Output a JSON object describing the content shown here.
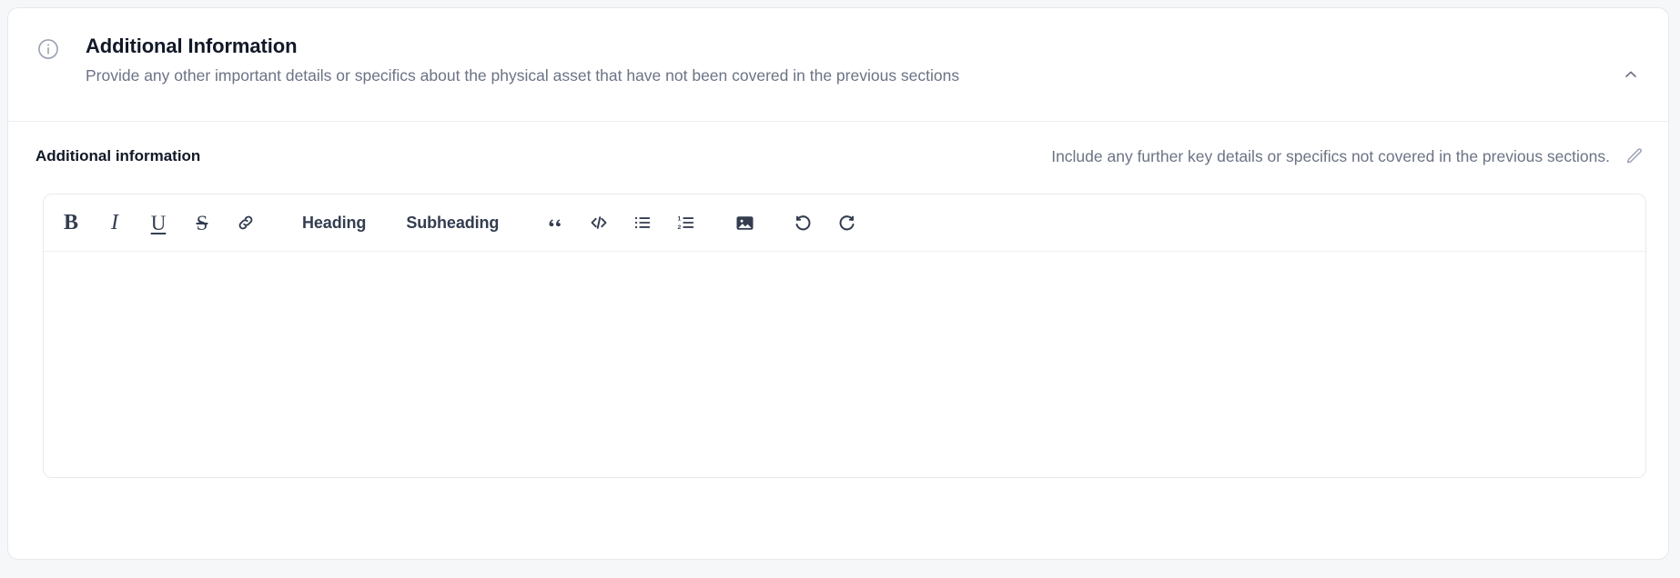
{
  "theme": {
    "page_background": "#f6f7f9",
    "card_background": "#ffffff",
    "border": "#e7e9ee",
    "title_color": "#111827",
    "muted_text": "#6b7385",
    "toolbar_icon": "#343d50"
  },
  "section": {
    "icon": "info-circle-icon",
    "title": "Additional Information",
    "subtitle": "Provide any other important details or specifics about the physical asset that have not been covered in the previous sections",
    "collapse_icon": "chevron-up-icon",
    "collapsed": false
  },
  "field": {
    "label": "Additional information",
    "hint": "Include any further key details or specifics not covered in the previous sections.",
    "edit_icon": "pencil-icon",
    "value": "",
    "placeholder": ""
  },
  "toolbar": {
    "items": [
      {
        "name": "bold-button",
        "glyph": "B",
        "label": "Bold"
      },
      {
        "name": "italic-button",
        "glyph": "I",
        "label": "Italic"
      },
      {
        "name": "underline-button",
        "glyph": "U",
        "label": "Underline"
      },
      {
        "name": "strikethrough-button",
        "glyph": "S",
        "label": "Strikethrough"
      },
      {
        "name": "link-button",
        "glyph": "link-icon",
        "label": "Link"
      },
      {
        "name": "heading-button",
        "glyph": "Heading",
        "label": "Heading"
      },
      {
        "name": "subheading-button",
        "glyph": "Subheading",
        "label": "Subheading"
      },
      {
        "name": "blockquote-button",
        "glyph": "quote-icon",
        "label": "Blockquote"
      },
      {
        "name": "code-block-button",
        "glyph": "code-icon",
        "label": "Code block"
      },
      {
        "name": "bulleted-list-button",
        "glyph": "bullet-list-icon",
        "label": "Bulleted list"
      },
      {
        "name": "numbered-list-button",
        "glyph": "numbered-list-icon",
        "label": "Numbered list"
      },
      {
        "name": "insert-image-button",
        "glyph": "image-icon",
        "label": "Insert image"
      },
      {
        "name": "undo-button",
        "glyph": "undo-icon",
        "label": "Undo"
      },
      {
        "name": "redo-button",
        "glyph": "redo-icon",
        "label": "Redo"
      }
    ],
    "heading_label": "Heading",
    "subheading_label": "Subheading",
    "bold_glyph": "B",
    "italic_glyph": "I",
    "underline_glyph": "U",
    "strike_glyph": "S"
  }
}
